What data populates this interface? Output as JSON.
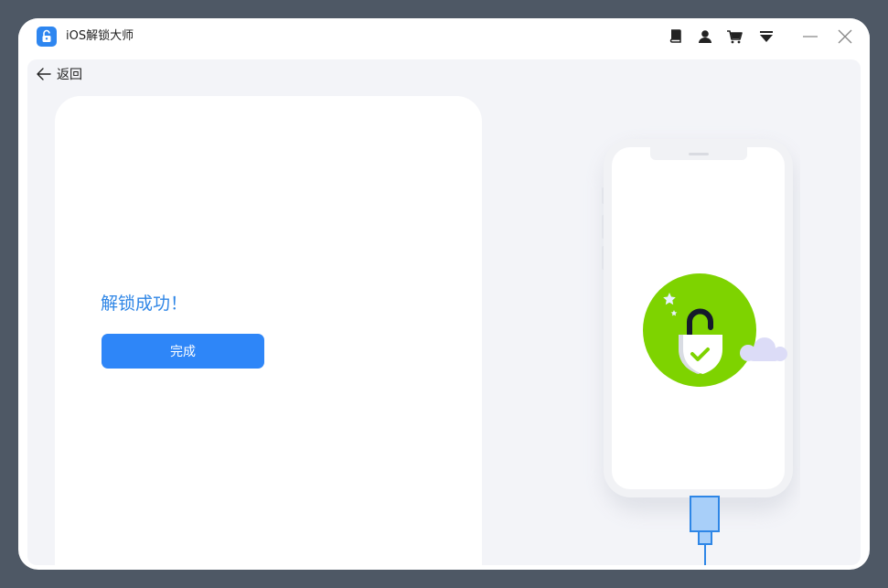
{
  "window": {
    "title": "iOS解锁大师"
  },
  "toolbar": {
    "icons": [
      "book-icon",
      "user-icon",
      "cart-icon",
      "menu-dropdown-icon",
      "minimize-icon",
      "close-icon"
    ]
  },
  "nav": {
    "back_label": "返回"
  },
  "result": {
    "message": "解锁成功！",
    "done_label": "完成"
  },
  "colors": {
    "accent": "#2e86f8",
    "success_green": "#7ed300",
    "message_blue": "#2f86e6",
    "background": "#f3f4f8",
    "backdrop": "#4e5865"
  }
}
